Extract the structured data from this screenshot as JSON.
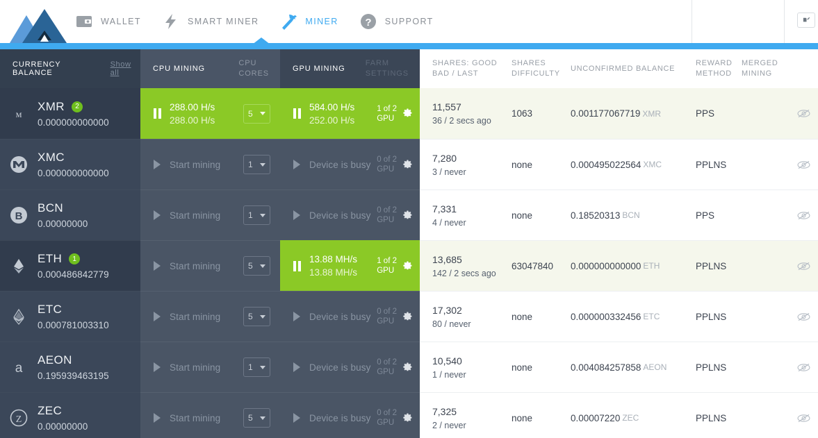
{
  "app": {
    "logo_name": "mountain-logo",
    "accent_blue": "#3faaf0",
    "accent_green": "#8bc926",
    "minimize_label": ""
  },
  "nav": {
    "items": [
      {
        "id": "wallet",
        "label": "WALLET",
        "icon": "wallet-icon",
        "active": false
      },
      {
        "id": "smart-miner",
        "label": "SMART MINER",
        "icon": "lightning-icon",
        "active": false
      },
      {
        "id": "miner",
        "label": "MINER",
        "icon": "pickaxe-icon",
        "active": true
      },
      {
        "id": "support",
        "label": "SUPPORT",
        "icon": "question-icon",
        "active": false
      }
    ]
  },
  "table": {
    "headers": {
      "currency_balance": "CURRENCY BALANCE",
      "show_all": "Show all",
      "cpu_mining": "CPU MINING",
      "cpu_cores_l1": "CPU",
      "cpu_cores_l2": "CORES",
      "gpu_mining": "GPU MINING",
      "farm_settings_l1": "FARM",
      "farm_settings_l2": "SETTINGS",
      "shares_l1": "SHARES: GOOD",
      "shares_l2": "BAD / LAST",
      "difficulty_l1": "SHARES",
      "difficulty_l2": "DIFFICULTY",
      "unconfirmed_balance": "UNCONFIRMED BALANCE",
      "reward_l1": "REWARD",
      "reward_l2": "METHOD",
      "merged_l1": "MERGED",
      "merged_l2": "MINING"
    },
    "rows": [
      {
        "icon": "xmr-icon",
        "symbol": "XMR",
        "badge": "2",
        "balance": "0.000000000000",
        "selected": true,
        "cpu": {
          "active": true,
          "label": "",
          "rate_a": "288.00 H/s",
          "rate_b": "288.00 H/s",
          "cores": "5"
        },
        "gpu": {
          "active": true,
          "label": "",
          "rate_a": "584.00 H/s",
          "rate_b": "252.00 H/s",
          "count_l1": "1 of 2",
          "count_l2": "GPU"
        },
        "shares_good": "11,557",
        "shares_bad_last": "36 / 2 secs ago",
        "difficulty": "1063",
        "unconfirmed": "0.001177067719",
        "unconfirmed_unit": "XMR",
        "reward": "PPS",
        "merged": ""
      },
      {
        "icon": "xmc-icon",
        "symbol": "XMC",
        "badge": "",
        "balance": "0.000000000000",
        "selected": false,
        "cpu": {
          "active": false,
          "label": "Start mining",
          "rate_a": "",
          "rate_b": "",
          "cores": "1"
        },
        "gpu": {
          "active": false,
          "label": "Device is busy",
          "rate_a": "",
          "rate_b": "",
          "count_l1": "0 of 2",
          "count_l2": "GPU"
        },
        "shares_good": "7,280",
        "shares_bad_last": "3 / never",
        "difficulty": "none",
        "unconfirmed": "0.000495022564",
        "unconfirmed_unit": "XMC",
        "reward": "PPLNS",
        "merged": ""
      },
      {
        "icon": "bcn-icon",
        "symbol": "BCN",
        "badge": "",
        "balance": "0.00000000",
        "selected": false,
        "cpu": {
          "active": false,
          "label": "Start mining",
          "rate_a": "",
          "rate_b": "",
          "cores": "1"
        },
        "gpu": {
          "active": false,
          "label": "Device is busy",
          "rate_a": "",
          "rate_b": "",
          "count_l1": "0 of 2",
          "count_l2": "GPU"
        },
        "shares_good": "7,331",
        "shares_bad_last": "4 / never",
        "difficulty": "none",
        "unconfirmed": "0.18520313",
        "unconfirmed_unit": "BCN",
        "reward": "PPS",
        "merged": ""
      },
      {
        "icon": "eth-icon",
        "symbol": "ETH",
        "badge": "1",
        "balance": "0.000486842779",
        "selected": true,
        "cpu": {
          "active": false,
          "label": "Start mining",
          "rate_a": "",
          "rate_b": "",
          "cores": "5"
        },
        "gpu": {
          "active": true,
          "label": "",
          "rate_a": "13.88 MH/s",
          "rate_b": "13.88 MH/s",
          "count_l1": "1 of 2",
          "count_l2": "GPU"
        },
        "shares_good": "13,685",
        "shares_bad_last": "142 / 2 secs ago",
        "difficulty": "63047840",
        "unconfirmed": "0.000000000000",
        "unconfirmed_unit": "ETH",
        "reward": "PPLNS",
        "merged": ""
      },
      {
        "icon": "etc-icon",
        "symbol": "ETC",
        "badge": "",
        "balance": "0.000781003310",
        "selected": false,
        "cpu": {
          "active": false,
          "label": "Start mining",
          "rate_a": "",
          "rate_b": "",
          "cores": "5"
        },
        "gpu": {
          "active": false,
          "label": "Device is busy",
          "rate_a": "",
          "rate_b": "",
          "count_l1": "0 of 2",
          "count_l2": "GPU"
        },
        "shares_good": "17,302",
        "shares_bad_last": "80 / never",
        "difficulty": "none",
        "unconfirmed": "0.000000332456",
        "unconfirmed_unit": "ETC",
        "reward": "PPLNS",
        "merged": ""
      },
      {
        "icon": "aeon-icon",
        "symbol": "AEON",
        "badge": "",
        "balance": "0.195939463195",
        "selected": false,
        "cpu": {
          "active": false,
          "label": "Start mining",
          "rate_a": "",
          "rate_b": "",
          "cores": "1"
        },
        "gpu": {
          "active": false,
          "label": "Device is busy",
          "rate_a": "",
          "rate_b": "",
          "count_l1": "0 of 2",
          "count_l2": "GPU"
        },
        "shares_good": "10,540",
        "shares_bad_last": "1 / never",
        "difficulty": "none",
        "unconfirmed": "0.004084257858",
        "unconfirmed_unit": "AEON",
        "reward": "PPLNS",
        "merged": ""
      },
      {
        "icon": "zec-icon",
        "symbol": "ZEC",
        "badge": "",
        "balance": "0.00000000",
        "selected": false,
        "cpu": {
          "active": false,
          "label": "Start mining",
          "rate_a": "",
          "rate_b": "",
          "cores": "5"
        },
        "gpu": {
          "active": false,
          "label": "Device is busy",
          "rate_a": "",
          "rate_b": "",
          "count_l1": "0 of 2",
          "count_l2": "GPU"
        },
        "shares_good": "7,325",
        "shares_bad_last": "2 / never",
        "difficulty": "none",
        "unconfirmed": "0.00007220",
        "unconfirmed_unit": "ZEC",
        "reward": "PPLNS",
        "merged": ""
      }
    ]
  }
}
